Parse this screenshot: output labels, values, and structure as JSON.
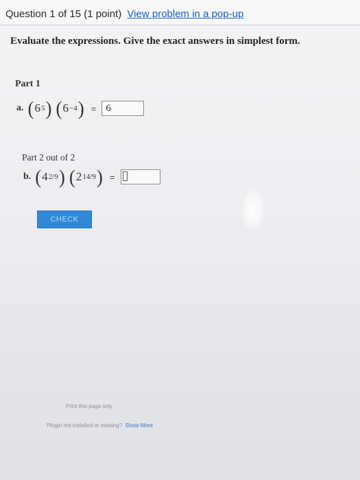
{
  "header": {
    "question_label": "Question 1 of 15 (1 point)",
    "popup_link": "View problem in a pop-up"
  },
  "instructions": "Evaluate the expressions. Give the exact answers in simplest form.",
  "part1": {
    "title": "Part 1",
    "label": "a.",
    "term1_base": "6",
    "term1_exp": "5",
    "term2_base": "6",
    "term2_exp": "−4",
    "equals": "=",
    "answer_value": "6"
  },
  "part2": {
    "title": "Part 2 out of 2",
    "label": "b.",
    "term1_base": "4",
    "term1_exp": "2/9",
    "term2_base": "2",
    "term2_exp": "14/9",
    "equals": "=",
    "answer_value": ""
  },
  "check_label": "CHECK",
  "footer": {
    "print_link": "Print this page only",
    "plugin_text": "Plugin not installed or missing?",
    "show_more": "Show More"
  }
}
